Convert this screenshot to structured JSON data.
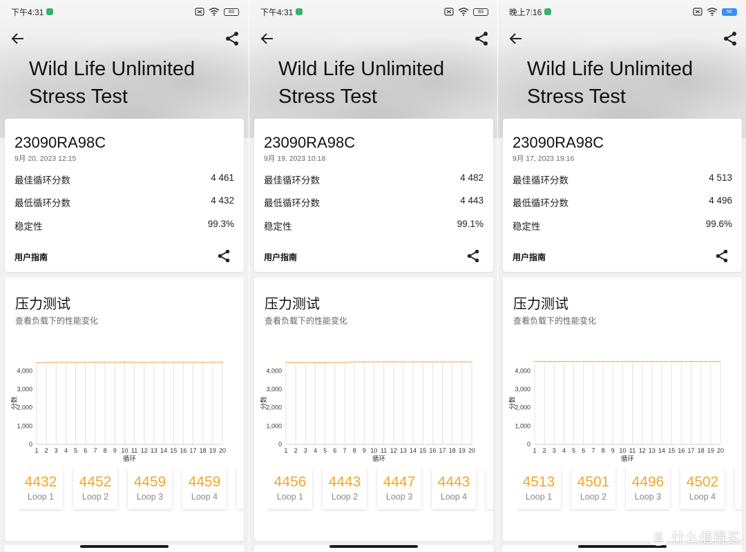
{
  "app": {
    "title_line1": "Wild Life Unlimited",
    "title_line2": "Stress Test",
    "device": "23090RA98C",
    "labels": {
      "best": "最佳循环分数",
      "worst": "最低循环分数",
      "stability": "稳定性",
      "guide": "用户指南",
      "section_title": "压力测试",
      "section_sub": "查看负载下的性能变化",
      "y_axis": "分数",
      "x_axis": "循环"
    },
    "loop_labels": [
      "Loop 1",
      "Loop 2",
      "Loop 3",
      "Loop 4"
    ]
  },
  "colors": {
    "accent": "#f5a623",
    "grid": "#e2e2e2",
    "line": "#f3b77a"
  },
  "panels": [
    {
      "status_time": "下午4:31",
      "battery": "83",
      "date": "9月 20, 2023 12:15",
      "best": "4 461",
      "worst": "4 432",
      "stability": "99.3%",
      "loops": [
        "4432",
        "4452",
        "4459",
        "4459"
      ]
    },
    {
      "status_time": "下午4:31",
      "battery": "83",
      "date": "9月 19, 2023 10:18",
      "best": "4 482",
      "worst": "4 443",
      "stability": "99.1%",
      "loops": [
        "4456",
        "4443",
        "4447",
        "4443"
      ]
    },
    {
      "status_time": "晚上7:16",
      "battery": "50",
      "date": "9月 17, 2023 19:16",
      "best": "4 513",
      "worst": "4 496",
      "stability": "99.6%",
      "loops": [
        "4513",
        "4501",
        "4496",
        "4502"
      ]
    }
  ],
  "chart_data": [
    {
      "type": "line",
      "x": [
        1,
        2,
        3,
        4,
        5,
        6,
        7,
        8,
        9,
        10,
        11,
        12,
        13,
        14,
        15,
        16,
        17,
        18,
        19,
        20
      ],
      "series": [
        {
          "values": [
            4432,
            4452,
            4459,
            4459,
            4455,
            4458,
            4460,
            4457,
            4459,
            4461,
            4458,
            4456,
            4459,
            4460,
            4457,
            4458,
            4459,
            4456,
            4458,
            4457
          ]
        }
      ],
      "xlabel": "循环",
      "ylabel": "分数",
      "yticks": [
        "0",
        "1,000",
        "2,000",
        "3,000",
        "4,000"
      ],
      "ylim": [
        0,
        4800
      ],
      "grid": true
    },
    {
      "type": "line",
      "x": [
        1,
        2,
        3,
        4,
        5,
        6,
        7,
        8,
        9,
        10,
        11,
        12,
        13,
        14,
        15,
        16,
        17,
        18,
        19,
        20
      ],
      "series": [
        {
          "values": [
            4456,
            4443,
            4447,
            4443,
            4445,
            4446,
            4450,
            4478,
            4480,
            4479,
            4482,
            4480,
            4478,
            4479,
            4481,
            4480,
            4478,
            4479,
            4480,
            4479
          ]
        }
      ],
      "xlabel": "循环",
      "ylabel": "分数",
      "yticks": [
        "0",
        "1,000",
        "2,000",
        "3,000",
        "4,000"
      ],
      "ylim": [
        0,
        4800
      ],
      "grid": true
    },
    {
      "type": "line",
      "x": [
        1,
        2,
        3,
        4,
        5,
        6,
        7,
        8,
        9,
        10,
        11,
        12,
        13,
        14,
        15,
        16,
        17,
        18,
        19,
        20
      ],
      "series": [
        {
          "values": [
            4513,
            4501,
            4496,
            4502,
            4505,
            4503,
            4506,
            4504,
            4502,
            4505,
            4503,
            4504,
            4506,
            4503,
            4505,
            4504,
            4502,
            4503,
            4505,
            4504
          ]
        }
      ],
      "xlabel": "循环",
      "ylabel": "分数",
      "yticks": [
        "0",
        "1,000",
        "2,000",
        "3,000",
        "4,000"
      ],
      "ylim": [
        0,
        4800
      ],
      "grid": true
    }
  ],
  "watermark": {
    "circle": "值",
    "text": "什么值得买"
  }
}
